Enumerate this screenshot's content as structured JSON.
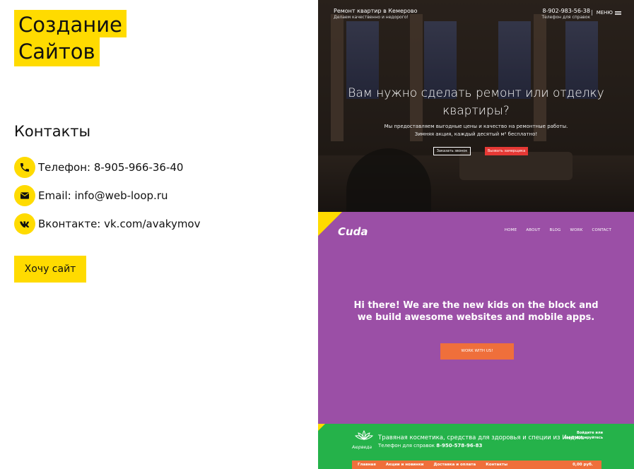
{
  "logo": {
    "line1": "Создание",
    "line2": "Сайтов"
  },
  "contacts": {
    "title": "Контакты",
    "items": [
      {
        "icon": "phone-icon",
        "text": "Телефон: 8-905-966-36-40"
      },
      {
        "icon": "envelope-icon",
        "text": "Email: info@web-loop.ru"
      },
      {
        "icon": "vk-icon",
        "text": "Вконтакте: vk.com/avakymov"
      }
    ]
  },
  "cta_label": "Хочу сайт",
  "colors": {
    "accent": "#ffdb00",
    "purple": "#9b4fa6",
    "green": "#25b24a",
    "orange": "#ef6f3b",
    "red": "#e53935"
  },
  "portfolio": {
    "repair": {
      "brand": "Ремонт квартир в Кемерово",
      "tagline": "Делаем качественно и недорого!",
      "phone": "8-902-983-56-38",
      "phone_note": "Телефон для справок",
      "menu": "МЕНЮ",
      "hero": "Вам нужно сделать ремонт или отделку квартиры?",
      "sub1": "Мы предоставляем выгодные цены и качество на ремонтные работы.",
      "sub2": "Зимняя акция, каждый десятый м² бесплатно!",
      "btn_call": "Заказать звонок",
      "btn_measure": "Вызвать замерщика"
    },
    "cuda": {
      "brand": "Cuda",
      "nav": [
        "HOME",
        "ABOUT",
        "BLOG",
        "WORK",
        "CONTACT"
      ],
      "hero": "Hi there! We are the new kids on the block and we build awesome websites and mobile apps.",
      "btn": "WORK WITH US!"
    },
    "ayurveda": {
      "brand": "Аюрведа",
      "title": "Травяная косметика, средства для здоровья и специи из Индии.",
      "phone_prefix": "Телефон для справок",
      "phone": "8-950-578-96-83",
      "login1": "Войдите или",
      "login2": "зарегистрируйтесь",
      "nav": [
        "Главная",
        "Акции и новинки",
        "Доставка и оплата",
        "Контакты"
      ],
      "cart": "0,00 руб."
    }
  }
}
